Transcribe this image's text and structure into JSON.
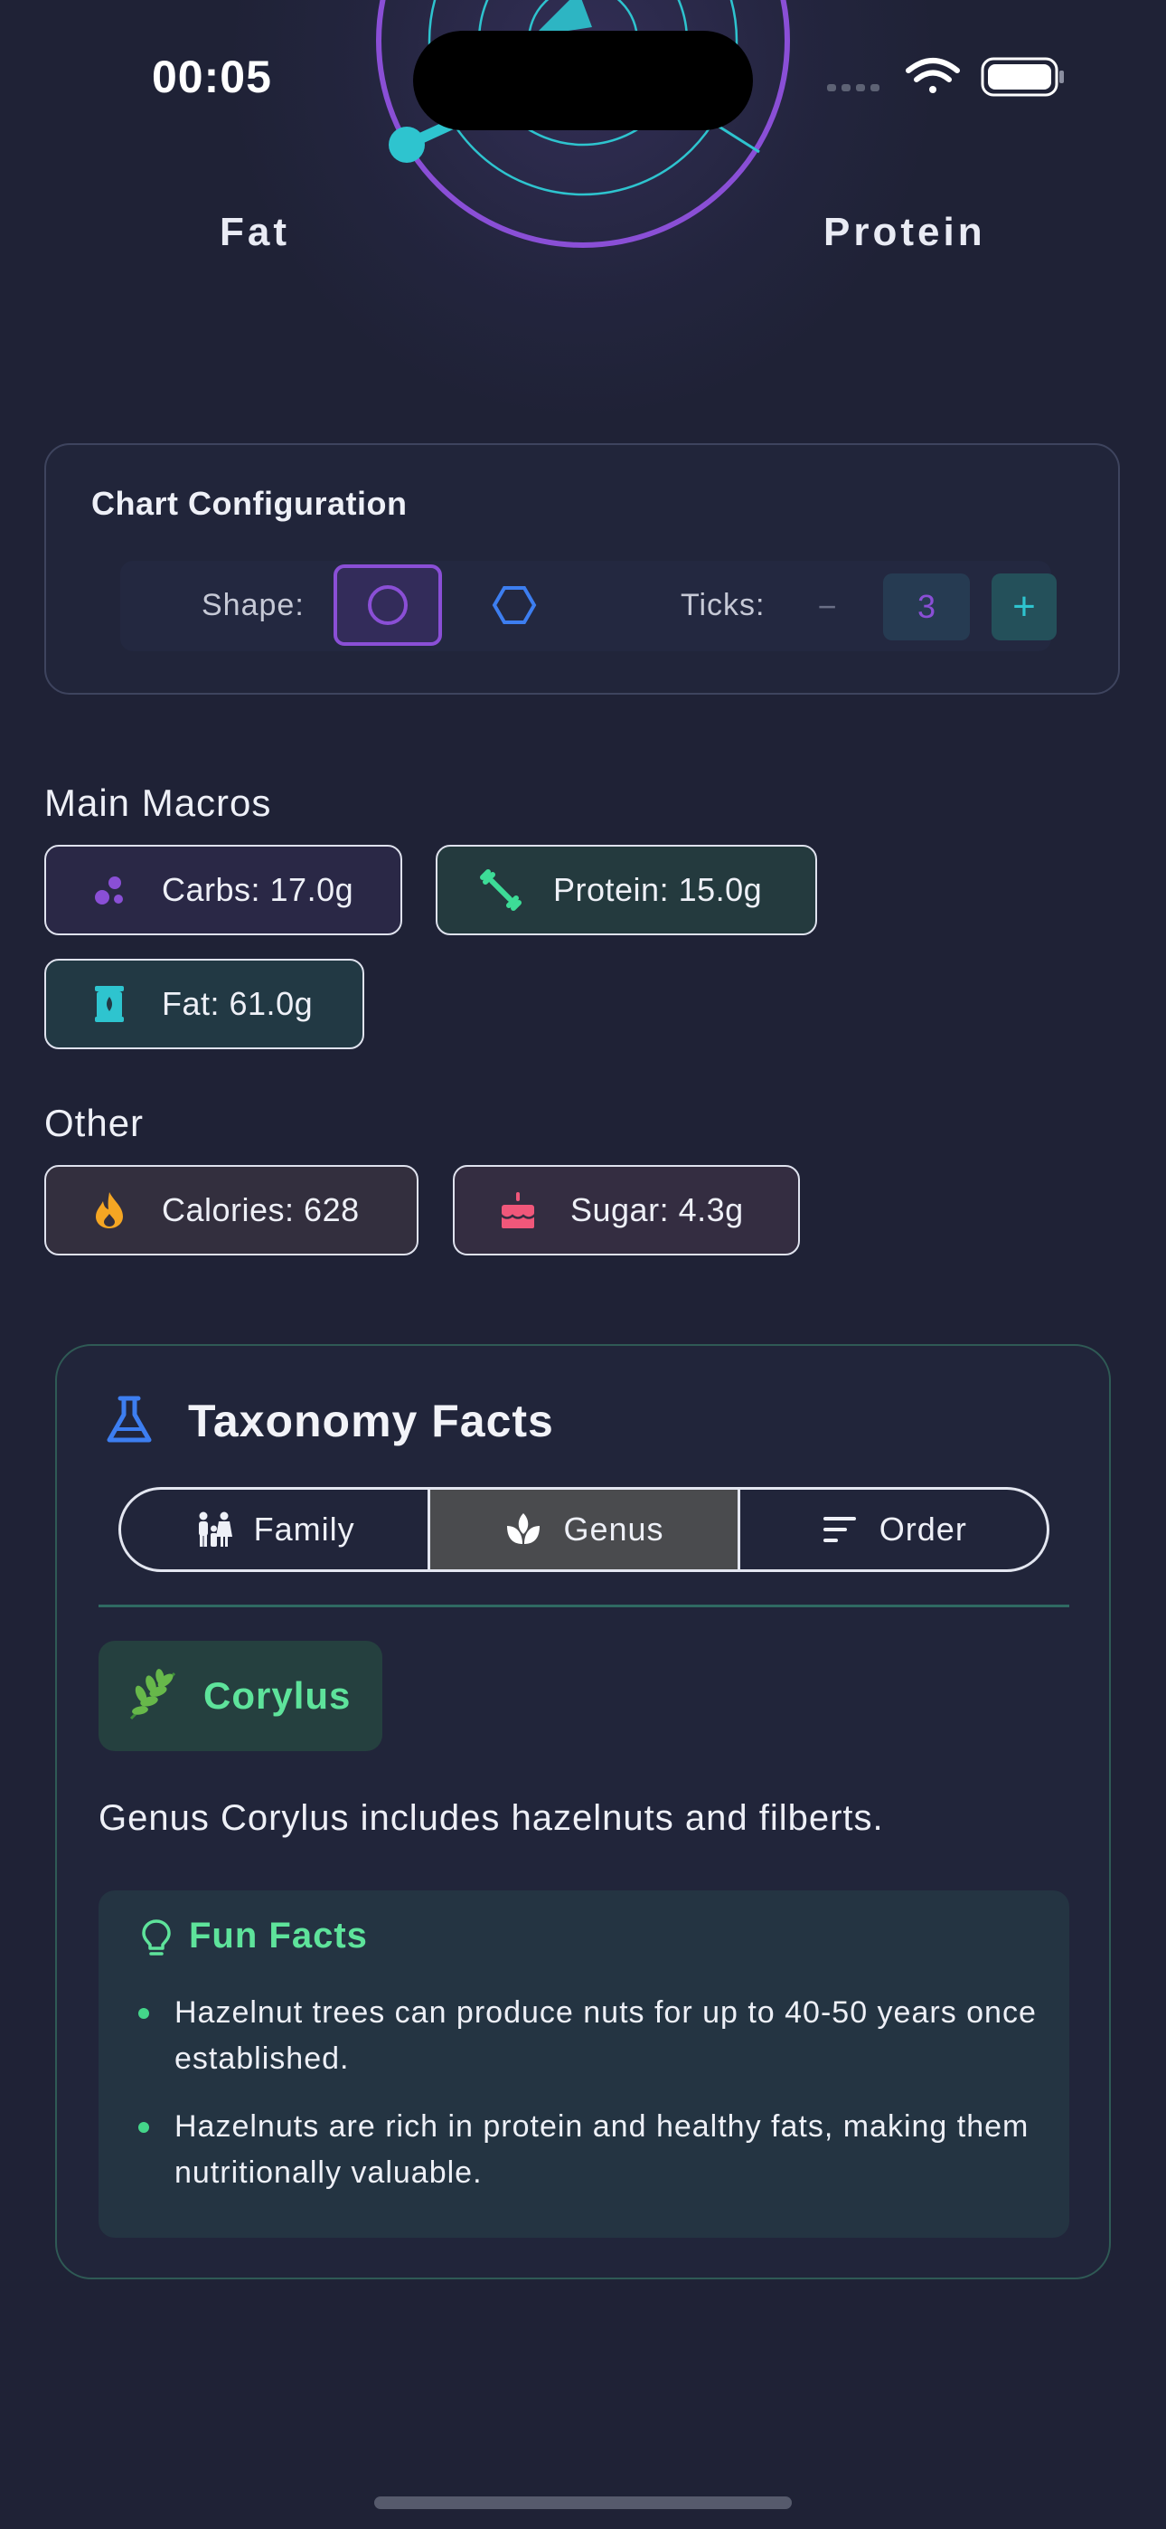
{
  "status_bar": {
    "time": "00:05"
  },
  "radar": {
    "axis_labels": [
      "Fat",
      "Protein"
    ]
  },
  "config": {
    "title": "Chart Configuration",
    "shape_label": "Shape:",
    "shapes": [
      "circle-icon",
      "hexagon-icon"
    ],
    "selected_shape": "circle",
    "ticks_label": "Ticks:",
    "ticks_value": "3",
    "decrement": "−",
    "increment": "+"
  },
  "main_macros": {
    "title": "Main Macros",
    "items": [
      {
        "label": "Carbs: 17.0g",
        "icon": "carbs-molecule-icon",
        "color": "#8a4fd6"
      },
      {
        "label": "Protein: 15.0g",
        "icon": "dumbbell-icon",
        "color": "#3ddc97"
      },
      {
        "label": "Fat: 61.0g",
        "icon": "oil-bottle-icon",
        "color": "#2ec4cf"
      }
    ]
  },
  "other": {
    "title": "Other",
    "items": [
      {
        "label": "Calories: 628",
        "icon": "flame-icon",
        "color": "#f5a623"
      },
      {
        "label": "Sugar: 4.3g",
        "icon": "cake-icon",
        "color": "#f0577a"
      }
    ]
  },
  "taxonomy": {
    "title": "Taxonomy Facts",
    "tabs": [
      "Family",
      "Genus",
      "Order"
    ],
    "active_tab": "Genus",
    "genus_name": "Corylus",
    "description": "Genus Corylus includes hazelnuts and filberts.",
    "fun_facts_title": "Fun Facts",
    "facts": [
      "Hazelnut trees can produce nuts for up to 40-50 years once established.",
      "Hazelnuts are rich in protein and healthy fats, making them nutritionally valuable."
    ]
  }
}
